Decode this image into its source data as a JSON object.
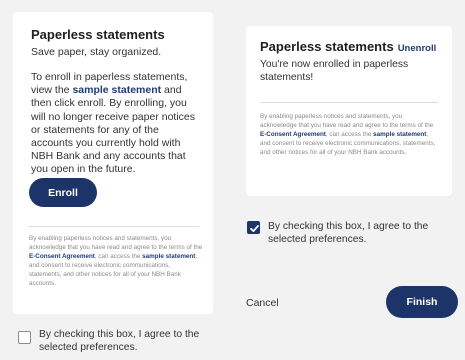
{
  "left": {
    "title": "Paperless statements",
    "subtitle": "Save paper, stay organized.",
    "body_1": "To enroll in paperless statements, view the ",
    "body_link": "sample statement",
    "body_2": " and then click enroll. By enrolling, you will no longer receive paper notices or statements for any of the accounts you currently hold with NBH Bank and any accounts that you open in the future.",
    "enroll_label": "Enroll",
    "fine_1": "By enabling paperless notices and statements, you acknowledge that you have read and agree to the terms of the ",
    "fine_link_1": "E-Consent Agreement",
    "fine_2": ", can access the ",
    "fine_link_2": "sample statement",
    "fine_3": ", and consent to receive electronic communications, statements, and other notices for all of your NBH Bank accounts.",
    "consent_label": "By checking this box, I agree to the selected preferences.",
    "consent_checked": false
  },
  "right": {
    "title": "Paperless statements",
    "unenroll_label": "Unenroll",
    "subtitle": "You're now enrolled in paperless statements!",
    "fine_1": "By enabling paperless notices and statements, you acknowledge that you have read and agree to the terms of the ",
    "fine_link_1": "E-Consent Agreement",
    "fine_2": ", can access the ",
    "fine_link_2": "sample statement",
    "fine_3": ", and consent to receive electronic communications, statements, and other notices for all of your NBH Bank accounts.",
    "consent_label": "By checking this box, I agree to the selected preferences.",
    "consent_checked": true,
    "cancel_label": "Cancel",
    "finish_label": "Finish"
  },
  "colors": {
    "brand_navy": "#1c3468",
    "link_blue": "#1f3b74",
    "background": "#f2f2f2",
    "card": "#ffffff"
  }
}
